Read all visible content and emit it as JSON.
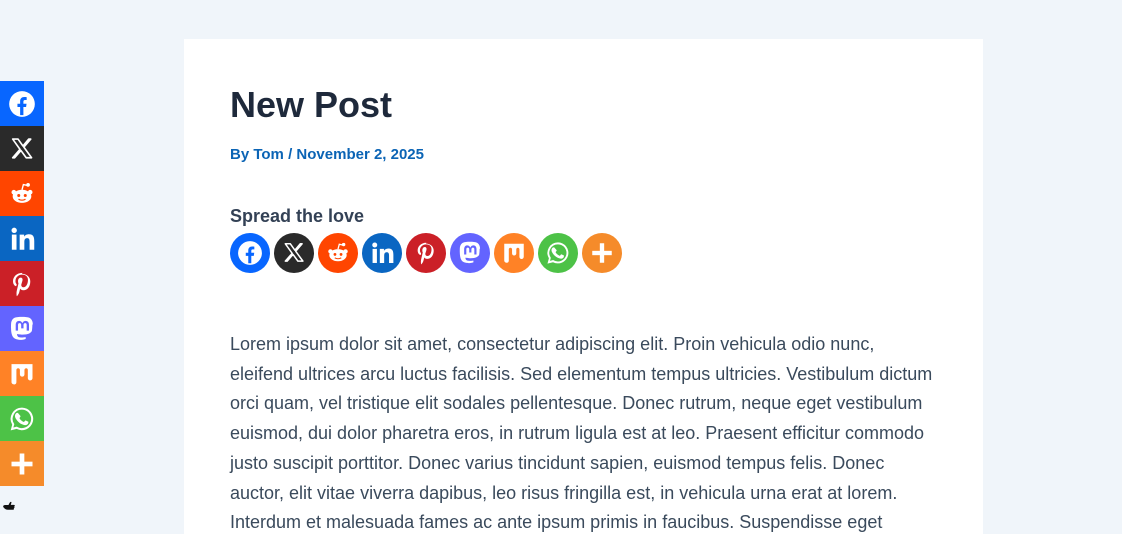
{
  "post": {
    "title": "New Post",
    "author_prefix": "By ",
    "author": "Tom",
    "separator": " / ",
    "date": "November 2, 2025",
    "share_heading": "Spread the love",
    "body": "Lorem ipsum dolor sit amet, consectetur adipiscing elit. Proin vehicula odio nunc, eleifend ultrices arcu luctus facilisis. Sed elementum tempus ultricies. Vestibulum dictum orci quam, vel tristique elit sodales pellentesque. Donec rutrum, neque eget vestibulum euismod, dui dolor pharetra eros, in rutrum ligula est at leo. Praesent efficitur commodo justo suscipit porttitor. Donec varius tincidunt sapien, euismod tempus felis. Donec auctor, elit vitae viverra dapibus, leo risus fringilla est, in vehicula urna erat at lorem. Interdum et malesuada fames ac ante ipsum primis in faucibus. Suspendisse eget"
  },
  "share_networks": [
    {
      "icon": "facebook-icon",
      "color": "#0866ff"
    },
    {
      "icon": "x-icon",
      "color": "#2a2a2a"
    },
    {
      "icon": "reddit-icon",
      "color": "#ff4500"
    },
    {
      "icon": "linkedin-icon",
      "color": "#0a66c2"
    },
    {
      "icon": "pinterest-icon",
      "color": "#cb2027"
    },
    {
      "icon": "mastodon-icon",
      "color": "#6364ff"
    },
    {
      "icon": "mix-icon",
      "color": "#ff8226"
    },
    {
      "icon": "whatsapp-icon",
      "color": "#4dc247"
    },
    {
      "icon": "more-icon",
      "color": "#f58b2a"
    }
  ],
  "colors": {
    "page_bg": "#f0f5fa",
    "card_bg": "#ffffff",
    "title": "#1e293b",
    "meta_link": "#0b64b5",
    "body_text": "#3a4a5c"
  },
  "hide_toggle_icon": "hand-pointer-icon"
}
